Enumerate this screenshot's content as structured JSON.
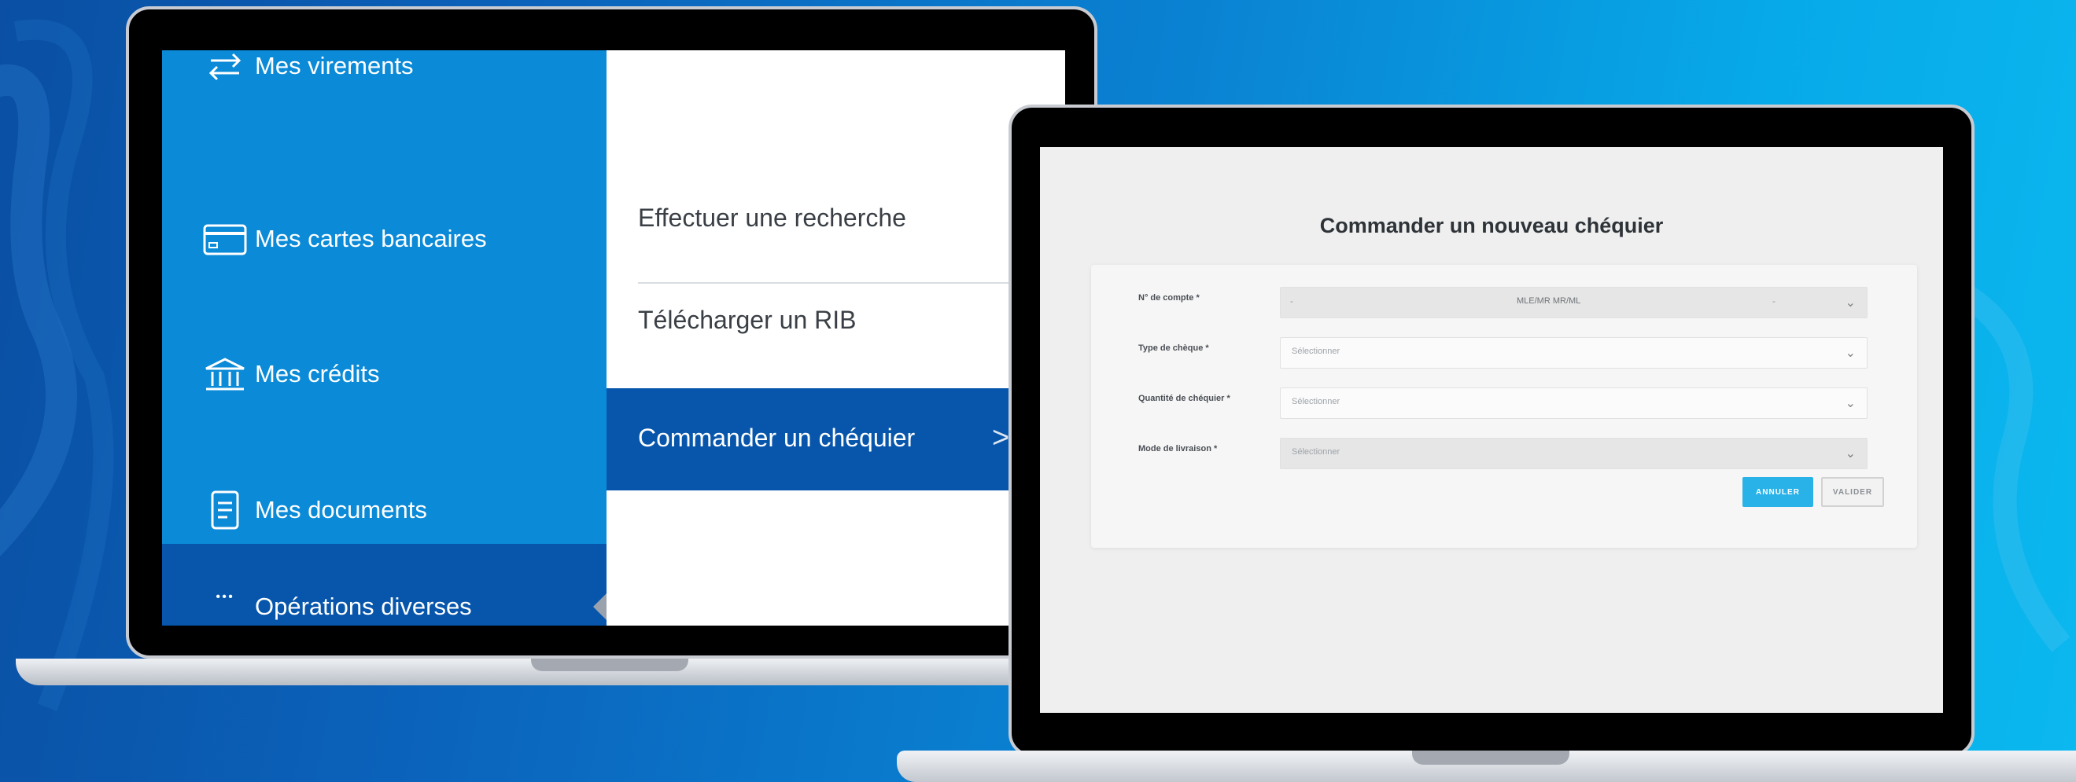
{
  "colors": {
    "sidebar_blue": "#0a8ad7",
    "active_blue": "#0756ab",
    "cancel_button": "#29b2e8"
  },
  "sidebar": {
    "items": [
      {
        "label": "Mes virements",
        "icon": "transfer-arrows-icon"
      },
      {
        "label": "Mes cartes bancaires",
        "icon": "credit-card-icon"
      },
      {
        "label": "Mes crédits",
        "icon": "bank-building-icon"
      },
      {
        "label": "Mes documents",
        "icon": "document-icon"
      },
      {
        "label": "Opérations diverses",
        "icon": "more-dots-icon",
        "active": true
      }
    ]
  },
  "submenu": {
    "items": [
      {
        "label": "Effectuer une recherche"
      },
      {
        "label": "Télécharger un RIB"
      },
      {
        "label": "Commander un chéquier",
        "active": true
      }
    ]
  },
  "form": {
    "title": "Commander un nouveau chéquier",
    "fields": [
      {
        "label": "N° de compte *",
        "value": "MLE/MR MR/ML"
      },
      {
        "label": "Type de chèque *",
        "value": "Sélectionner"
      },
      {
        "label": "Quantité de chéquier *",
        "value": "Sélectionner"
      },
      {
        "label": "Mode de livraison *",
        "value": "Sélectionner"
      }
    ],
    "cancel_label": "ANNULER",
    "submit_label": "VALIDER"
  }
}
